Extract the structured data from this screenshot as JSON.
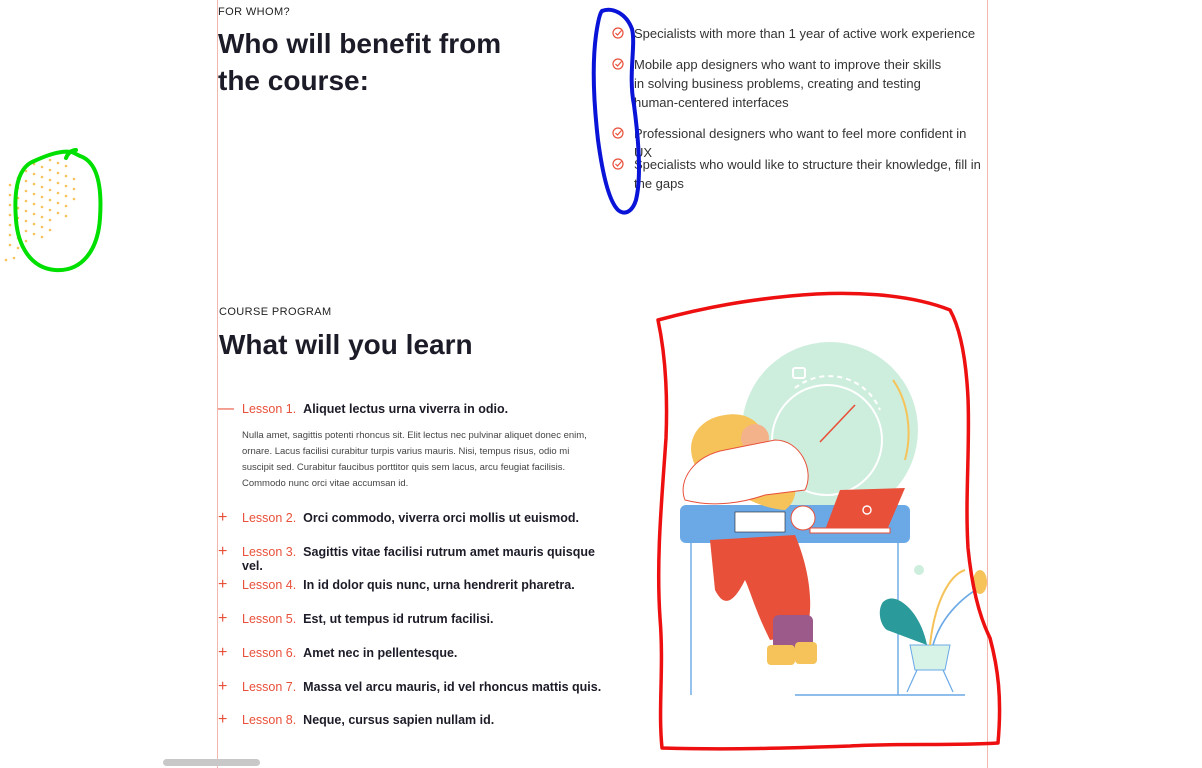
{
  "audience": {
    "eyebrow": "FOR WHOM?",
    "title_line1": "Who will benefit from",
    "title_line2": "the course:",
    "items": [
      "Specialists with more than 1 year of active work experience",
      "Mobile app designers who want to improve their skills in solving business problems, creating and testing human-centered interfaces",
      "Professional designers who want to feel more confident in UX",
      "Specialists who would like to structure their knowledge, fill in the gaps"
    ]
  },
  "program": {
    "eyebrow": "COURSE PROGRAM",
    "title": "What will you learn",
    "lessons": [
      {
        "number": "Lesson 1.",
        "title": "Aliquet lectus urna viverra in odio.",
        "toggle": "—"
      },
      {
        "number": "Lesson 2.",
        "title": "Orci commodo, viverra orci mollis ut euismod.",
        "toggle": "+"
      },
      {
        "number": "Lesson 3.",
        "title": "Sagittis vitae facilisi rutrum amet mauris quisque vel.",
        "toggle": "+"
      },
      {
        "number": "Lesson 4.",
        "title": "In id dolor quis nunc, urna hendrerit pharetra.",
        "toggle": "+"
      },
      {
        "number": "Lesson 5.",
        "title": "Est, ut tempus id rutrum facilisi.",
        "toggle": "+"
      },
      {
        "number": "Lesson 6.",
        "title": "Amet nec in pellentesque.",
        "toggle": "+"
      },
      {
        "number": "Lesson 7.",
        "title": "Massa vel arcu mauris, id vel rhoncus mattis quis.",
        "toggle": "+"
      },
      {
        "number": "Lesson 8.",
        "title": "Neque, cursus sapien nullam id.",
        "toggle": "+"
      }
    ],
    "lesson1_description": "Nulla amet, sagittis potenti rhoncus sit. Elit lectus nec pulvinar aliquet donec enim, ornare. Lacus facilisi curabitur turpis varius mauris. Nisi, tempus risus, odio mi suscipit sed. Curabitur faucibus porttitor quis sem lacus, arcu feugiat facilisis. Commodo nunc orci vitae accumsan id."
  },
  "colors": {
    "accent": "#e8503a",
    "annotation_green": "#00e000",
    "annotation_blue": "#0a14d8",
    "annotation_red": "#ee1010",
    "dots": "#f6c35a"
  },
  "icons": [
    "check-circle-icon",
    "minus-icon",
    "plus-icon"
  ]
}
